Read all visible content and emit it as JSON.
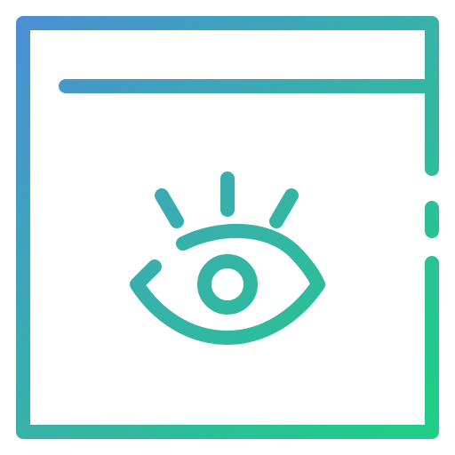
{
  "icon": {
    "name": "browser-window-eye-icon",
    "parts": [
      "window-frame-icon",
      "title-bar-line",
      "eye-icon",
      "eyelashes-icon",
      "pupil-icon"
    ]
  },
  "colors": {
    "gradient_start": "#4a8fd6",
    "gradient_mid": "#36b2a8",
    "gradient_end": "#1ecf84",
    "background": "#ffffff"
  }
}
